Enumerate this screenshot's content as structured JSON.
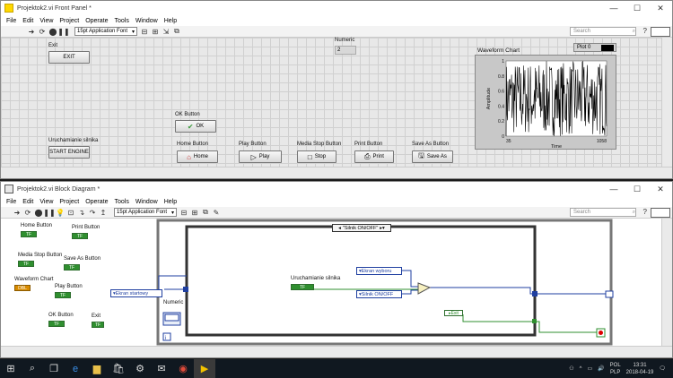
{
  "front_panel": {
    "title": "Projektok2.vi Front Panel *",
    "menu": [
      "File",
      "Edit",
      "View",
      "Project",
      "Operate",
      "Tools",
      "Window",
      "Help"
    ],
    "toolbar": {
      "font": "15pt Application Font",
      "search_placeholder": "Search"
    },
    "controls": {
      "exit": {
        "label": "Exit",
        "text": "EXIT"
      },
      "numeric": {
        "label": "Numeric",
        "value": "2"
      },
      "ok": {
        "label": "OK Button",
        "text": "OK"
      },
      "engine": {
        "label": "Uruchamianie silnika",
        "text": "START ENGINE"
      },
      "home": {
        "label": "Home Button",
        "text": "Home"
      },
      "play": {
        "label": "Play Button",
        "text": "Play"
      },
      "stop": {
        "label": "Media Stop Button",
        "text": "Stop"
      },
      "print": {
        "label": "Print Button",
        "text": "Print"
      },
      "saveas": {
        "label": "Save As Button",
        "text": "Save As"
      }
    }
  },
  "chart_data": {
    "type": "line",
    "title": "Waveform Chart",
    "legend": "Plot 0",
    "xlabel": "Time",
    "ylabel": "Amplitude",
    "xlim": [
      35,
      1058
    ],
    "ylim": [
      0,
      1
    ],
    "yticks": [
      "1",
      "0.8",
      "0.6",
      "0.4",
      "0.2",
      "0"
    ],
    "xticks": [
      "35",
      "1058"
    ]
  },
  "block_diagram": {
    "title": "Projektok2.vi Block Diagram *",
    "menu": [
      "File",
      "Edit",
      "View",
      "Project",
      "Operate",
      "Tools",
      "Window",
      "Help"
    ],
    "toolbar": {
      "font": "15pt Application Font",
      "search_placeholder": "Search"
    },
    "terminals": {
      "home": "Home Button",
      "print": "Print Button",
      "media_stop": "Media Stop Button",
      "save_as": "Save As Button",
      "waveform": "Waveform Chart",
      "play": "Play Button",
      "ok": "OK Button",
      "exit": "Exit",
      "numeric": "Numeric",
      "engine": "Uruchamianie silnika"
    },
    "nodes": {
      "case_selector": "\"Silnik ON/OFF\"",
      "ekran_startowy": "Ekran startowy",
      "ekran_wyboru": "Ekran wyboru",
      "silnik_onoff": "Silnik ON/OFF",
      "exit_const": "Exit"
    }
  },
  "taskbar": {
    "lang1": "POL",
    "lang2": "PLP",
    "time": "13:31",
    "date": "2018-04-19"
  }
}
